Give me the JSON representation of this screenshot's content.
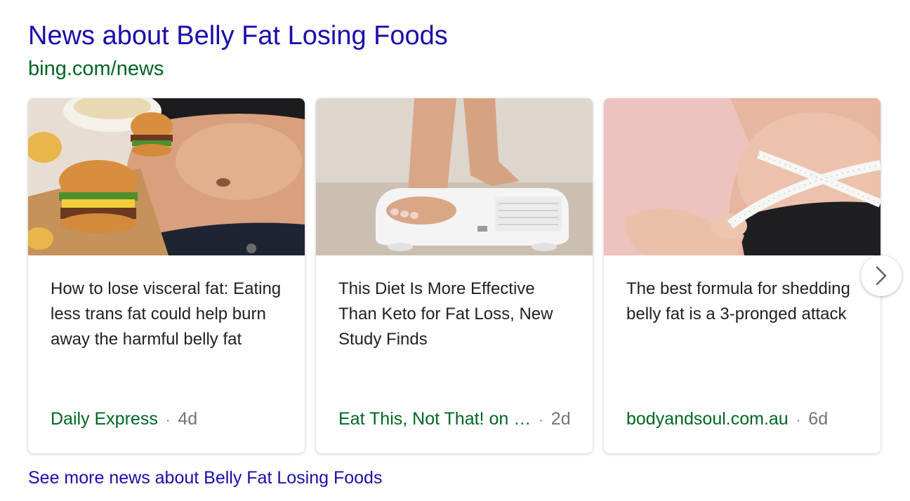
{
  "header": {
    "title": "News about Belly Fat Losing Foods",
    "source_url": "bing.com/news"
  },
  "cards": [
    {
      "headline": "How to lose visceral fat: Eating less trans fat could help burn away the harmful belly fat",
      "source": "Daily Express",
      "separator": "·",
      "age": "4d",
      "image_icon": "belly-and-burgers-image"
    },
    {
      "headline": "This Diet Is More Effective Than Keto for Fat Loss, New Study Finds",
      "source": "Eat This, Not That! on …",
      "separator": "·",
      "age": "2d",
      "image_icon": "feet-on-scale-image"
    },
    {
      "headline": "The best formula for shedding belly fat is a 3-pronged attack",
      "source": "bodyandsoul.com.au",
      "separator": "·",
      "age": "6d",
      "image_icon": "waist-measuring-tape-image"
    }
  ],
  "carousel": {
    "next_icon": "chevron-right-icon"
  },
  "footer": {
    "more_link": "See more news about Belly Fat Losing Foods"
  },
  "colors": {
    "title_link": "#1a0dab",
    "source_green": "#006621",
    "meta_gray": "#70757a",
    "headline_text": "#202124"
  }
}
